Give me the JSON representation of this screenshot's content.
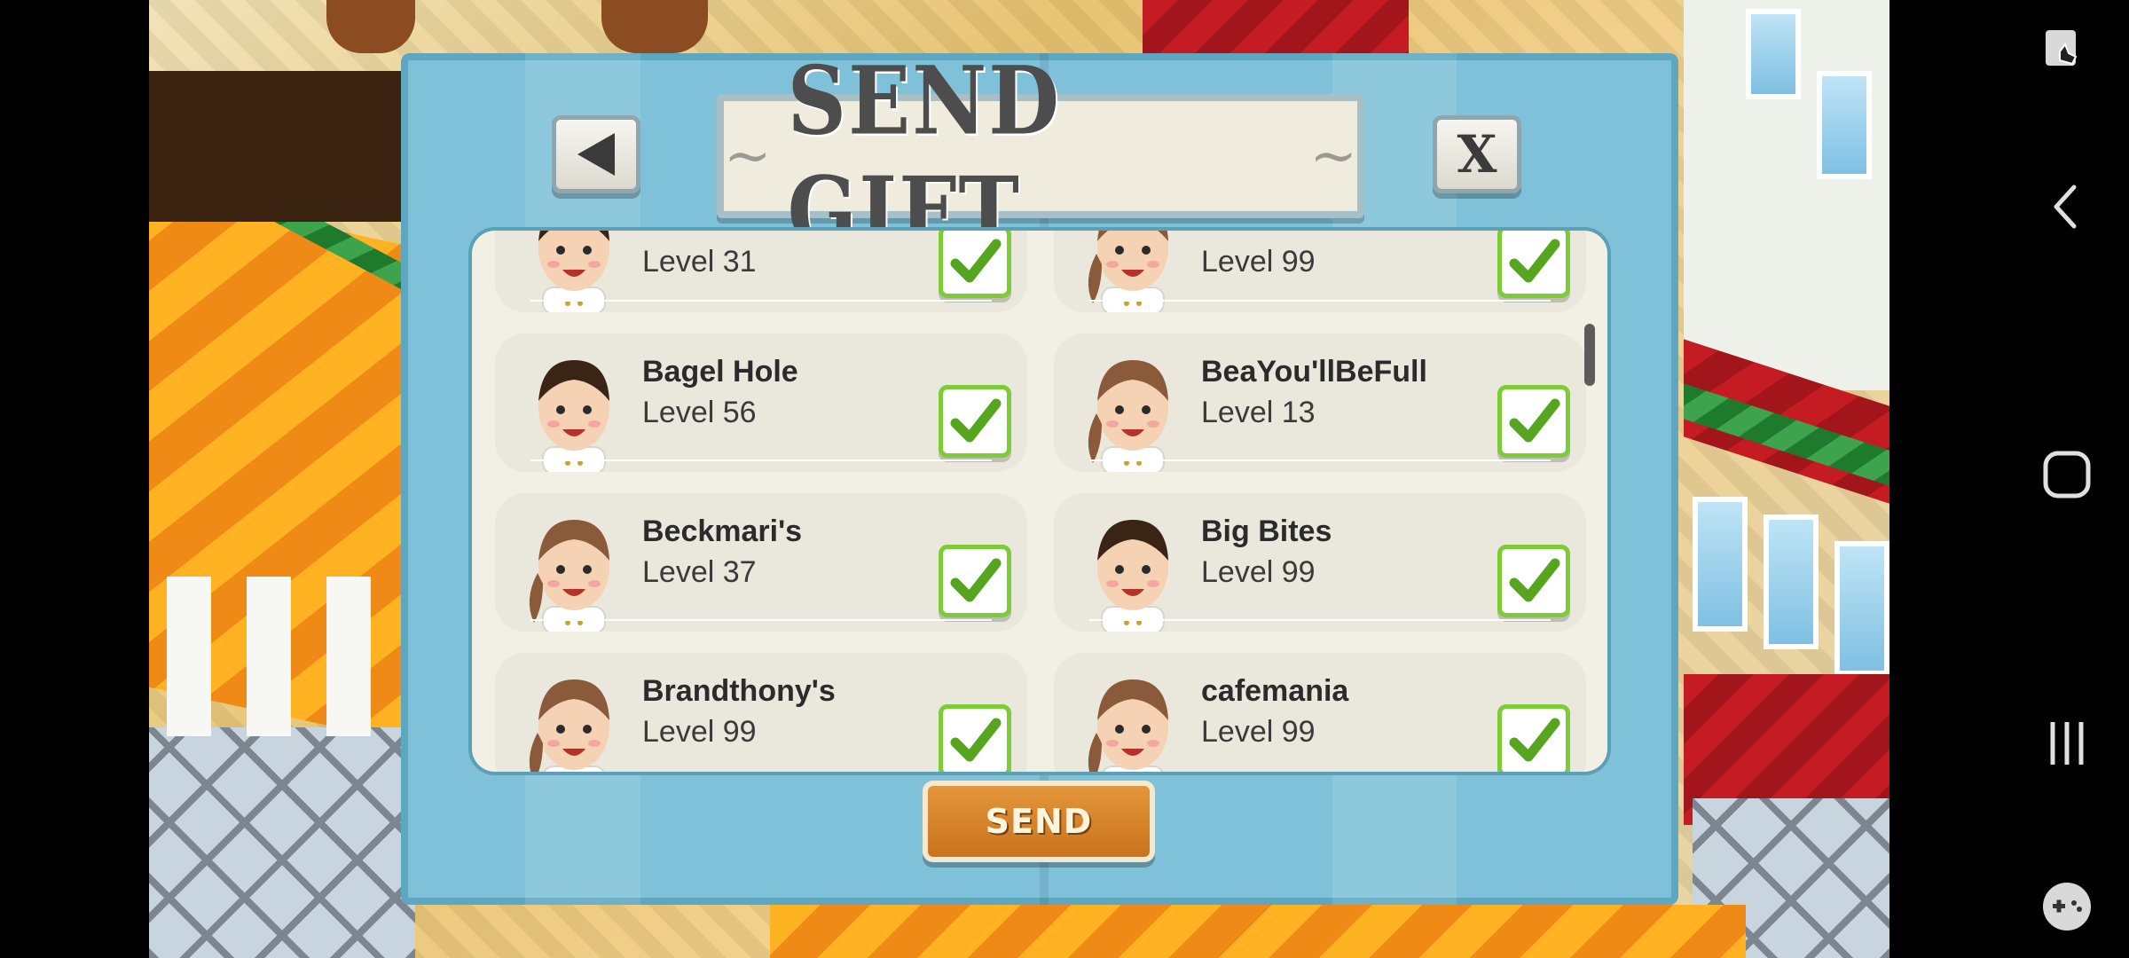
{
  "dialog": {
    "title": "SEND GIFT",
    "send_label": "SEND"
  },
  "friends": [
    {
      "name": "",
      "level": "Level 31",
      "gender": "male",
      "checked": true
    },
    {
      "name": "",
      "level": "Level 99",
      "gender": "female",
      "checked": true
    },
    {
      "name": "Bagel Hole",
      "level": "Level 56",
      "gender": "male",
      "checked": true
    },
    {
      "name": "BeaYou'llBeFull",
      "level": "Level 13",
      "gender": "female",
      "checked": true
    },
    {
      "name": "Beckmari's",
      "level": "Level 37",
      "gender": "female",
      "checked": true
    },
    {
      "name": "Big Bites",
      "level": "Level 99",
      "gender": "male",
      "checked": true
    },
    {
      "name": "Brandthony's",
      "level": "Level 99",
      "gender": "female",
      "checked": true
    },
    {
      "name": "cafemania",
      "level": "Level 99",
      "gender": "female",
      "checked": true
    }
  ],
  "nav": {
    "icons": [
      "screenshot-edit-icon",
      "back-icon",
      "home-icon",
      "recents-icon",
      "game-tools-icon"
    ]
  },
  "colors": {
    "dialog_bg": "#7fc1d9",
    "check_green": "#7ccc35",
    "send_orange": "#d88428"
  }
}
